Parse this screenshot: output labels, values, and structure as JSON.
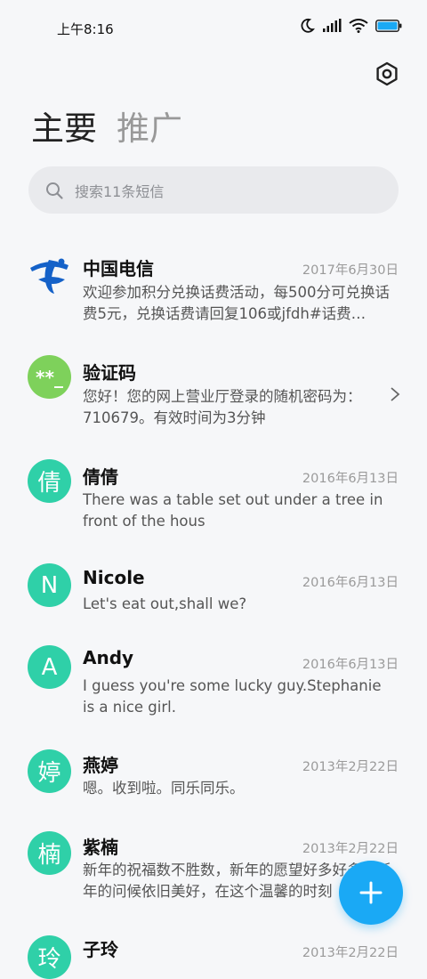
{
  "status": {
    "time": "上午8:16",
    "battery": ""
  },
  "tabs": [
    {
      "label": "主要"
    },
    {
      "label": "推广"
    }
  ],
  "search": {
    "placeholder": "搜索11条短信"
  },
  "conversations": [
    {
      "name": "中国电信",
      "date": "2017年6月30日",
      "preview": "欢迎参加积分兑换话费活动，每500分可兑换话费5元，兑换话费请回复106或jfdh#话费…",
      "avatar": "china-telecom-logo"
    },
    {
      "name": "验证码",
      "date": "",
      "preview": "您好！您的网上营业厅登录的随机密码为：710679。有效时间为3分钟",
      "avatar_text": "**_"
    },
    {
      "name": "倩倩",
      "date": "2016年6月13日",
      "preview": "There was a table set out under a tree in front of the hous",
      "avatar_text": "倩"
    },
    {
      "name": "Nicole",
      "date": "2016年6月13日",
      "preview": "Let's eat out,shall we?",
      "avatar_text": "N"
    },
    {
      "name": "Andy",
      "date": "2016年6月13日",
      "preview": "I guess you're some lucky guy.Stephanie is a nice girl.",
      "avatar_text": "A"
    },
    {
      "name": "燕婷",
      "date": "2013年2月22日",
      "preview": "嗯。收到啦。同乐同乐。",
      "avatar_text": "婷"
    },
    {
      "name": "紫楠",
      "date": "2013年2月22日",
      "preview": "新年的祝福数不胜数，新年的愿望好多好多，新年的问候依旧美好，在这个温馨的时刻",
      "avatar_text": "楠"
    },
    {
      "name": "子玲",
      "date": "2013年2月22日",
      "preview": "",
      "avatar_text": "玲"
    }
  ],
  "colors": {
    "accent": "#1aa9f5",
    "avatar_teal": "#2fd0a8",
    "avatar_green": "#7ed15b",
    "telecom_blue": "#1461c8"
  },
  "icons": {
    "settings": "gear-icon",
    "search": "search-icon",
    "fab": "plus-icon",
    "chevron": "chevron-right-icon"
  }
}
